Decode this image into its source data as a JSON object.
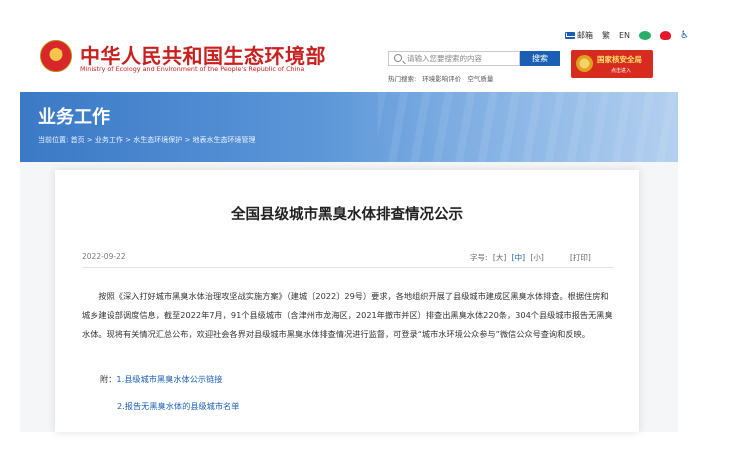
{
  "header": {
    "site_title": "中华人民共和国生态环境部",
    "site_subtitle": "Ministry of Ecology and Environment of the People's Republic of China",
    "links": {
      "mail": "邮箱",
      "traditional": "繁",
      "english": "EN"
    },
    "search": {
      "placeholder": "请输入您要搜索的内容",
      "button": "搜索",
      "hot_label": "热门搜索:",
      "hot_items": [
        "环境影响评价",
        "空气质量"
      ]
    },
    "badge": {
      "title": "国家核安全局",
      "sub": "点击进入"
    }
  },
  "banner": {
    "title": "业务工作",
    "breadcrumb": "当前位置:  首页 > 业务工作 > 水生态环境保护 > 地表水生态环境管理"
  },
  "article": {
    "title": "全国县级城市黑臭水体排查情况公示",
    "date": "2022-09-22",
    "font_label": "字号:",
    "font_sizes": [
      "[大]",
      "[中]",
      "[小]"
    ],
    "print": "[打印]",
    "body": "按照《深入打好城市黑臭水体治理攻坚战实施方案》（建城〔2022〕29号）要求，各地组织开展了县级城市建成区黑臭水体排查。根据住房和城乡建设部调度信息，截至2022年7月，91个县级城市（含津州市龙海区，2021年撤市并区）排查出黑臭水体220条，304个县级城市报告无黑臭水体。现将有关情况汇总公布，欢迎社会各界对县级城市黑臭水体排查情况进行监督，可登录“城市水环境公众参与”微信公众号查询和反映。",
    "attach_prefix": "附：",
    "attachments": [
      "1.县级城市黑臭水体公示链接",
      "2.报告无黑臭水体的县级城市名单"
    ]
  }
}
